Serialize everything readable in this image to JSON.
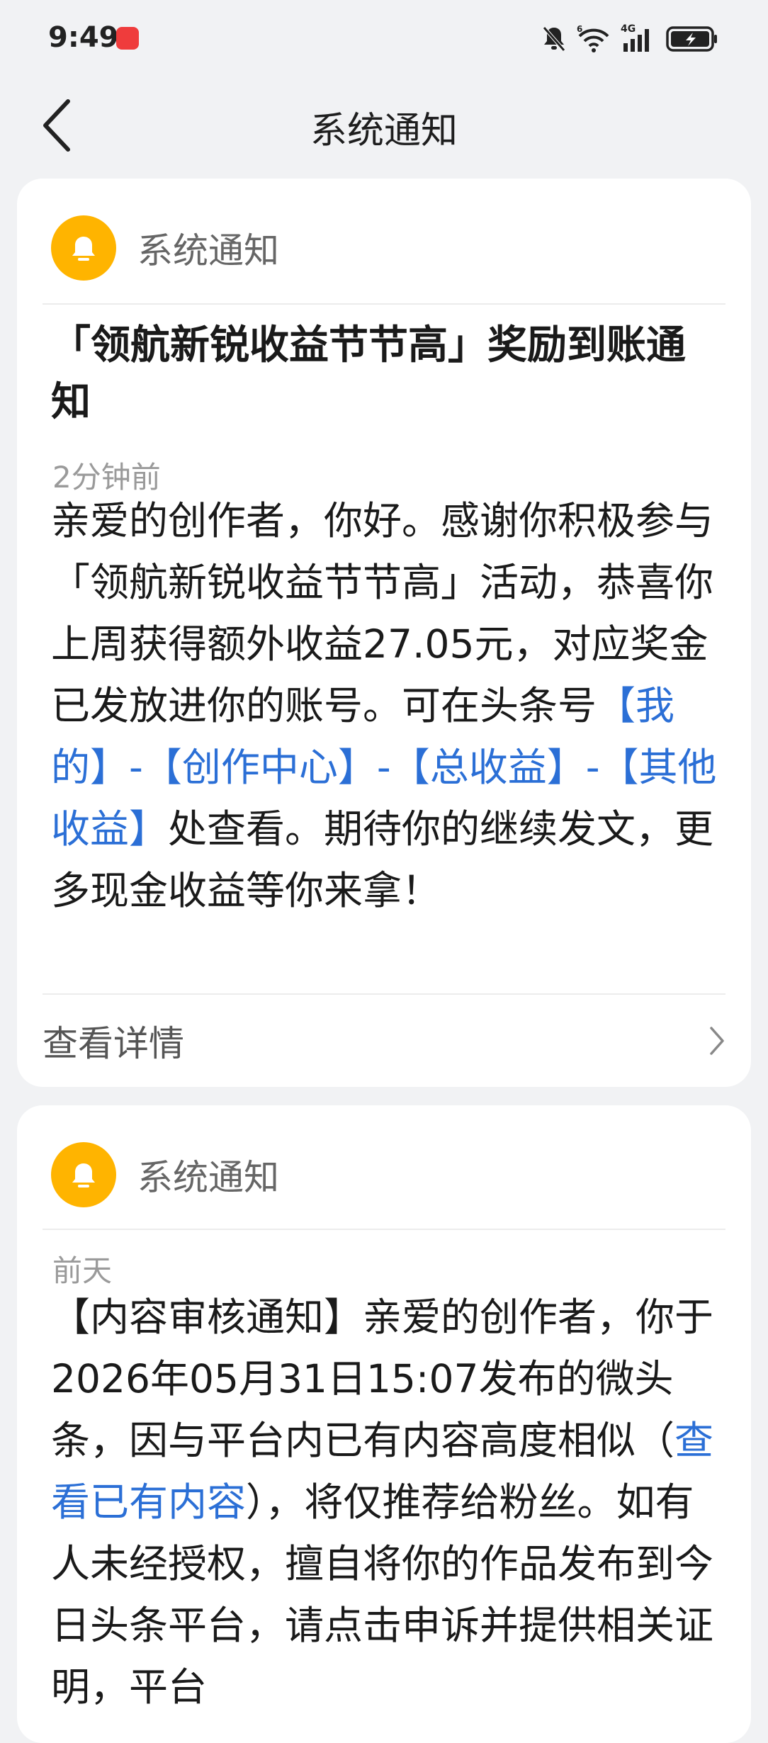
{
  "status_bar": {
    "time": "9:49",
    "icons": [
      "app-badge-icon",
      "mute-bell-icon",
      "wifi-6-icon",
      "signal-4g-icon",
      "battery-charging-icon"
    ],
    "network_label": "4G"
  },
  "nav": {
    "title": "系统通知",
    "back_icon": "chevron-left-icon"
  },
  "notifications": [
    {
      "sender": "系统通知",
      "avatar_icon": "bell-icon",
      "title": "「领航新锐收益节节高」奖励到账通知",
      "time": "2分钟前",
      "body_parts": [
        {
          "text": "亲爱的创作者，你好。感谢你积极参与「领航新锐收益节节高」活动，恭喜你上周获得额外收益27.05元，对应奖金已发放进你的账号。可在头条号",
          "link": false
        },
        {
          "text": "【我的】-【创作中心】-【总收益】-【其他收益】",
          "link": true
        },
        {
          "text": "处查看。期待你的继续发文，更多现金收益等你来拿！",
          "link": false
        }
      ],
      "detail_label": "查看详情",
      "detail_icon": "chevron-right-icon"
    },
    {
      "sender": "系统通知",
      "avatar_icon": "bell-icon",
      "time": "前天",
      "body_parts": [
        {
          "text": "【内容审核通知】亲爱的创作者，你于2026年05月31日15:07发布的微头条，因与平台内已有内容高度相似（",
          "link": false
        },
        {
          "text": "查看已有内容",
          "link": true
        },
        {
          "text": "），将仅推荐给粉丝。如有人未经授权，擅自将你的作品发布到今日头条平台，请点击申诉并提供相关证明，平台",
          "link": false
        }
      ]
    }
  ],
  "colors": {
    "background": "#f1f2f4",
    "card": "#ffffff",
    "avatar": "#ffb400",
    "link": "#2b6fd6",
    "secondary_text": "#9a9a9a"
  }
}
